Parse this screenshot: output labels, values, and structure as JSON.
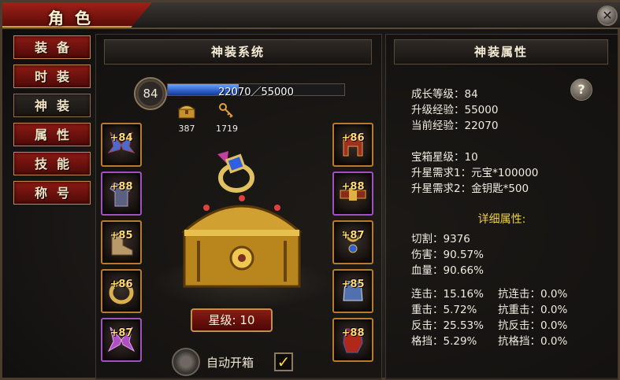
{
  "window": {
    "title": "角色"
  },
  "nav": {
    "items": [
      {
        "label": "装备"
      },
      {
        "label": "时装"
      },
      {
        "label": "神装"
      },
      {
        "label": "属性"
      },
      {
        "label": "技能"
      },
      {
        "label": "称号"
      }
    ],
    "active_index": 2
  },
  "system": {
    "header": "神装系统",
    "level": "84",
    "exp_text": "22070／55000",
    "exp_current": 22070,
    "exp_max": 55000,
    "resources": [
      {
        "icon": "treasure-chest-icon",
        "value": "387"
      },
      {
        "icon": "golden-key-icon",
        "value": "1719"
      }
    ],
    "left_slots": [
      {
        "level": "+84",
        "icon": "wings-icon"
      },
      {
        "level": "+88",
        "icon": "armor-icon"
      },
      {
        "level": "+85",
        "icon": "boots-icon"
      },
      {
        "level": "+86",
        "icon": "ring-icon"
      },
      {
        "level": "+87",
        "icon": "wings-icon"
      }
    ],
    "right_slots": [
      {
        "level": "+86",
        "icon": "helmet-icon"
      },
      {
        "level": "+88",
        "icon": "belt-icon"
      },
      {
        "level": "+87",
        "icon": "necklace-icon"
      },
      {
        "level": "+85",
        "icon": "bracer-icon"
      },
      {
        "level": "+88",
        "icon": "gauntlet-icon"
      }
    ],
    "star_label": "星级:",
    "star_value": "10",
    "auto_open_label": "自动开箱",
    "auto_open_checked": true,
    "checkmark": "✓"
  },
  "attributes": {
    "header": "神装属性",
    "help_label": "?",
    "growth_level": "成长等级：84",
    "upgrade_exp": "升级经验：55000",
    "current_exp": "当前经验：22070",
    "chest_star": "宝箱星级：10",
    "req1": "升星需求1：元宝*100000",
    "req2": "升星需求2：金钥匙*500",
    "detail_title": "详细属性:",
    "basic": [
      "切割：9376",
      "伤害：90.57%",
      "血量：90.66%"
    ],
    "pairs": [
      [
        "连击：15.16%",
        "抗连击：0.0%"
      ],
      [
        "重击：5.72%",
        "抗重击：0.0%"
      ],
      [
        "反击：25.53%",
        "抗反击：0.0%"
      ],
      [
        "格挡：5.29%",
        "抗格挡：0.0%"
      ]
    ]
  },
  "colors": {
    "accent_red": "#8c1a14",
    "gold": "#c08a50",
    "exp_blue": "#2c5ec8",
    "detail_yellow": "#f0d04a"
  },
  "close_label": "✕"
}
